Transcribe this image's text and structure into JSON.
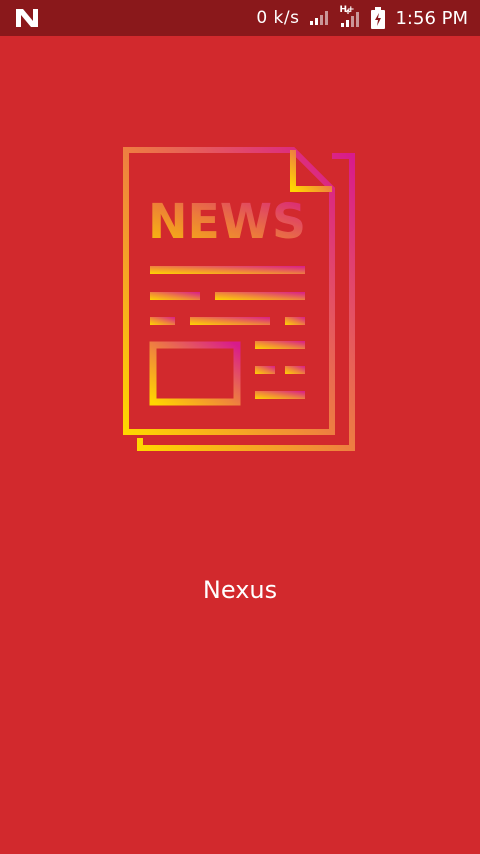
{
  "status_bar": {
    "notification_icon": "n-logo-icon",
    "network_speed": "0 k/s",
    "signal1_icon": "cellular-signal-icon",
    "network_type": "H+",
    "signal2_icon": "cellular-signal-icon",
    "battery_icon": "battery-charging-icon",
    "time": "1:56 PM"
  },
  "splash": {
    "logo_icon": "newspaper-icon",
    "logo_text": "NEWS",
    "app_name": "Nexus"
  },
  "colors": {
    "background": "#d2292d",
    "status_bar": "#8a181b",
    "gradient_start": "#ffd600",
    "gradient_end": "#d81b8c"
  }
}
